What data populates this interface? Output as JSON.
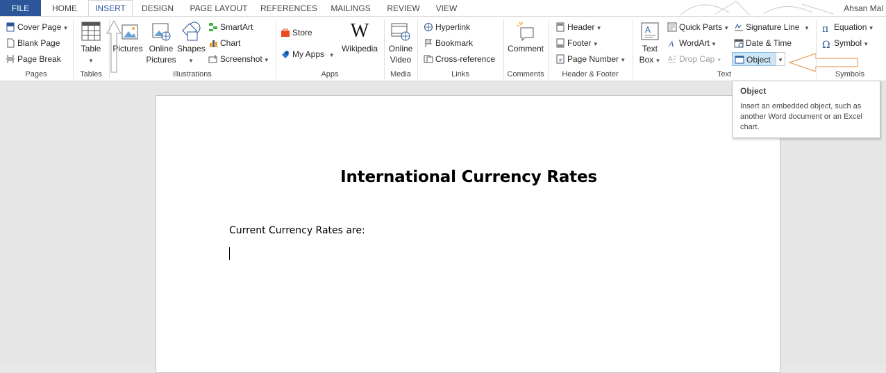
{
  "tabs": {
    "file": "FILE",
    "home": "HOME",
    "insert": "INSERT",
    "design": "DESIGN",
    "page_layout": "PAGE LAYOUT",
    "references": "REFERENCES",
    "mailings": "MAILINGS",
    "review": "REVIEW",
    "view": "VIEW"
  },
  "user": "Ahsan Mal",
  "ribbon": {
    "pages": {
      "cover_page": "Cover Page",
      "blank_page": "Blank Page",
      "page_break": "Page Break",
      "label": "Pages"
    },
    "tables": {
      "table": "Table",
      "label": "Tables"
    },
    "illustrations": {
      "pictures": "Pictures",
      "online_pictures_1": "Online",
      "online_pictures_2": "Pictures",
      "shapes": "Shapes",
      "smartart": "SmartArt",
      "chart": "Chart",
      "screenshot": "Screenshot",
      "label": "Illustrations"
    },
    "apps": {
      "store": "Store",
      "my_apps": "My Apps",
      "wikipedia": "Wikipedia",
      "label": "Apps"
    },
    "media": {
      "online_video_1": "Online",
      "online_video_2": "Video",
      "label": "Media"
    },
    "links": {
      "hyperlink": "Hyperlink",
      "bookmark": "Bookmark",
      "cross_reference": "Cross-reference",
      "label": "Links"
    },
    "comments": {
      "comment": "Comment",
      "label": "Comments"
    },
    "header_footer": {
      "header": "Header",
      "footer": "Footer",
      "page_number": "Page Number",
      "label": "Header & Footer"
    },
    "text": {
      "text_box_1": "Text",
      "text_box_2": "Box",
      "quick_parts": "Quick Parts",
      "wordart": "WordArt",
      "drop_cap": "Drop Cap",
      "signature_line": "Signature Line",
      "date_time": "Date & Time",
      "object": "Object",
      "label": "Text"
    },
    "symbols": {
      "equation": "Equation",
      "symbol": "Symbol",
      "label": "Symbols"
    }
  },
  "tooltip": {
    "title": "Object",
    "body": "Insert an embedded object, such as another Word document or an Excel chart."
  },
  "document": {
    "title": "International Currency Rates",
    "line1": "Current Currency Rates are:"
  },
  "colors": {
    "accent": "#2b579a",
    "highlight": "#cde6f7",
    "arrow": "#e8a060"
  }
}
